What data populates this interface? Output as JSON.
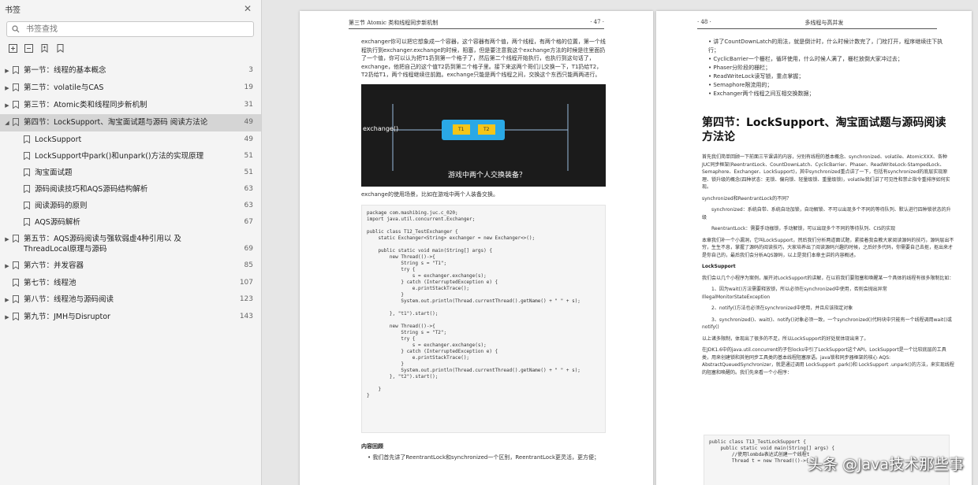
{
  "sidebar": {
    "title": "书签",
    "search_placeholder": "书签查找",
    "items": [
      {
        "label": "第一节：线程的基本概念",
        "page": "3"
      },
      {
        "label": "第二节：volatile与CAS",
        "page": "19"
      },
      {
        "label": "第三节：Atomic类和线程同步新机制",
        "page": "31"
      },
      {
        "label": "第四节：LockSupport、淘宝面试题与源码  阅读方法论",
        "page": "49"
      },
      {
        "label": "LockSupport",
        "page": "49"
      },
      {
        "label": "LockSupport中park()和unpark()方法的实现原理",
        "page": "51"
      },
      {
        "label": "淘宝面试题",
        "page": "51"
      },
      {
        "label": "源码阅读技巧和AQS源码结构解析",
        "page": "63"
      },
      {
        "label": "阅读源码的原则",
        "page": "63"
      },
      {
        "label": "AQS源码解析",
        "page": "67"
      },
      {
        "label": "第五节：AQS源码阅读与强软弱虚4种引用以  及ThreadLocal原理与源码",
        "page": "69"
      },
      {
        "label": "第六节：并发容器",
        "page": "85"
      },
      {
        "label": "第七节：线程池",
        "page": "107"
      },
      {
        "label": "第八节：线程池与源码阅读",
        "page": "123"
      },
      {
        "label": "第九节：JMH与Disruptor",
        "page": "143"
      }
    ]
  },
  "left_page": {
    "header_left": "第三节   Atomic 类和线程同步新机制",
    "header_right": "· 47 ·",
    "intro": "exchanger你可以把它想象成一个容器，这个容器有两个值，两个线程，有两个格的位置，第一个线程执行到exchanger.exchange的时候，阻塞，但是要注意我这个exchange方法的时候是往里面扔了一个值，你可以认为把T1扔到第一个格子了，然后第二个线程开始执行，也执行到这句话了，exchange，他把自己的这个值T2扔到第二个格子里。接下来这两个哥们儿交换一下，T1扔给T2，T2扔给T1，两个线程继续往前跑。exchange只能是两个线程之间，交换这个东西只能两两进行。",
    "figure_label": "exchange()",
    "figure_t1": "T1",
    "figure_t2": "T2",
    "figure_caption": "游戏中两个人交换装备？",
    "after_figure": "exchange的使用场景，比如在游戏中两个人装备交换。",
    "code_lines": [
      "package com.mashibing.juc.c_020;",
      "import java.util.concurrent.Exchanger;",
      "",
      "public class T12_TestExchanger {",
      "    static Exchanger<String> exchanger = new Exchanger<>();",
      "",
      "    public static void main(String[] args) {",
      "        new Thread(()->{",
      "            String s = \"T1\";",
      "            try {",
      "                s = exchanger.exchange(s);",
      "            } catch (InterruptedException e) {",
      "                e.printStackTrace();",
      "            }",
      "            System.out.println(Thread.currentThread().getName() + \" \" + s);",
      "",
      "        }, \"t1\").start();",
      "",
      "        new Thread(()->{",
      "            String s = \"T2\";",
      "            try {",
      "                s = exchanger.exchange(s);",
      "            } catch (InterruptedException e) {",
      "                e.printStackTrace();",
      "            }",
      "            System.out.println(Thread.currentThread().getName() + \" \" + s);",
      "        }, \"t2\").start();",
      "",
      "    }",
      "}"
    ],
    "review_title": "内容回顾",
    "review_bullet": "我们首先讲了ReentrantLock和synchronized一个区别，ReentrantLock更灵活，更方便；"
  },
  "right_page": {
    "header_left": "· 48 ·",
    "header_right": "多线程与高并发",
    "bullets": [
      "讲了CountDownLatch的用法，就是倒计时，什么时候计数完了，门栓打开，程序继续往下执行；",
      "CyclicBarrier一个栅栏，循环使用，什么时候人满了，栅栏放倒大家冲过去；",
      "Phaser分阶段的栅栏；",
      "ReadWriteLock读写锁，重点掌握；",
      "Semaphore限流用的；",
      "Exchanger两个线程之间互相交换数据；"
    ],
    "section_title": "第四节：LockSupport、淘宝面试题与源码阅读方法论",
    "p1": "首先我们简单回顾一下前面三节课讲的内容，分别有线程的基本概念、synchronized、volatile、AtomicXXX、各种JUC同步框架(ReentrantLock、CountDownLatch、CyclicBarrier、Phaser、ReadWriteLock-StampedLock、Semaphore、Exchanger、LockSupport)，其中synchronized重点讲了一下，包括有synchronized的底层实现原理、锁升级的概念(四种状态：无锁、偏向锁、轻量级锁、重量级锁)，volatile我们讲了可见性和禁止指令重排序如何实现。",
    "p2": "synchronized和ReentrantLock的不同？",
    "p3": "synchronized：系统自带、系统自动加锁，自动解锁、不可以出现多个不同的等待队列、默认进行四种锁状态的升级",
    "p4": "ReentrantLock：需要手动枷锁，手动解锁，可以出现多个不同的等待队列、CIS的实现",
    "p5": "本章我们补一个小漏洞，它叫LockSupport，然后我们分析两道面试题，紧接着我会教大家阅读源码的技巧，源码层出不穷，生生不息，掌握了源码的阅读技巧，大家培养出了阅读源码兴趣的时候，之后好多代码，你需要自己去抠，抠出来才是你自己的，最后我们会分析AQS源码，以上是我们本章主讲的内容概述。",
    "ls_title": "LockSupport",
    "p6": "我们会以几个小程序为案例，展开对LockSupport的讲解，在以前我们要阻塞和唤醒某一个具体的线程有很多限制比如：",
    "p7": "1、因为wait()方法需要释放锁，所以必须在synchronized中使用，否则会抛出异常IllegalMonitorStateException",
    "p8": "2、notify()方法也必须在synchronized中使用，并且应该指定对象",
    "p9": "3、synchronized()、wait()、notify()对象必须一致，一个synchronized()代码块中只能有一个线程调用wait()或notify()",
    "p10": "以上诸多限制，体现出了很多的不足，所以LockSupport的好处就体现出来了。",
    "p11": "在JDK1.6中的java.util.concurrent的子包locks中引了LockSupport这个API，LockSupport是一个比较底层的工具类，用来创建锁和其他同步工具类的基本线程阻塞原语。java锁和同步器框架的核心 AQS: AbstractQueuedSynchronizer，就是通过调用 LockSupport .park()和 LockSupport .unpark()的方法，来实现线程的阻塞和唤醒的。我们先来看一个小程序：",
    "code_lines": [
      "public class T13_TestLockSupport {",
      "    public static void main(String[] args) {",
      "        //使用lombda表达式创建一个线程t",
      "        Thread t = new Thread(()->{"
    ]
  },
  "watermark": "头条 @Java技术那些事"
}
